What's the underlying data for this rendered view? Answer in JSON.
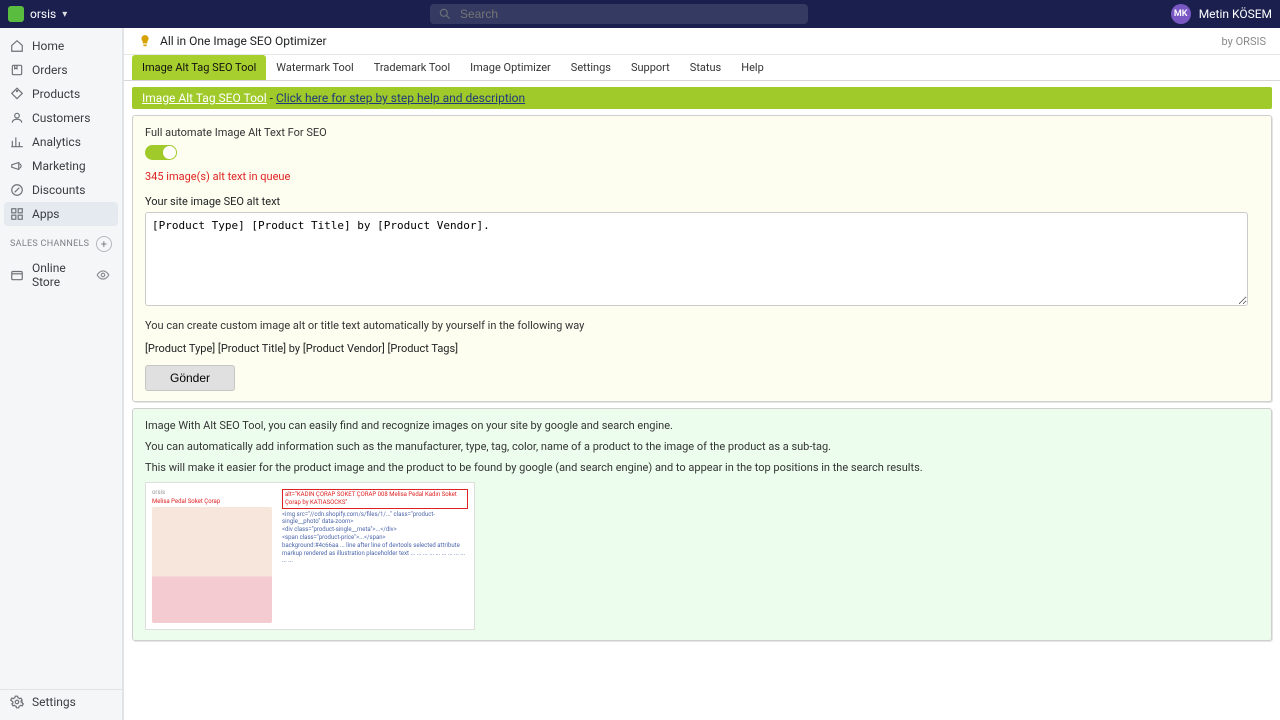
{
  "topbar": {
    "store_name": "orsis",
    "search_placeholder": "Search",
    "user_initials": "MK",
    "user_name": "Metin KÖSEM"
  },
  "sidebar": {
    "items": [
      {
        "label": "Home"
      },
      {
        "label": "Orders"
      },
      {
        "label": "Products"
      },
      {
        "label": "Customers"
      },
      {
        "label": "Analytics"
      },
      {
        "label": "Marketing"
      },
      {
        "label": "Discounts"
      },
      {
        "label": "Apps"
      }
    ],
    "channels_header": "SALES CHANNELS",
    "channels": [
      {
        "label": "Online Store"
      }
    ],
    "settings_label": "Settings"
  },
  "app": {
    "title": "All in One Image SEO Optimizer",
    "by_vendor": "by ORSIS"
  },
  "tabs": {
    "items": [
      {
        "label": "Image Alt Tag SEO Tool"
      },
      {
        "label": "Watermark Tool"
      },
      {
        "label": "Trademark Tool"
      },
      {
        "label": "Image Optimizer"
      },
      {
        "label": "Settings"
      },
      {
        "label": "Support"
      },
      {
        "label": "Status"
      },
      {
        "label": "Help"
      }
    ]
  },
  "greenbar": {
    "title": "Image Alt Tag SEO Tool",
    "sep": " - ",
    "link": "Click here for step by step help and description"
  },
  "panel": {
    "automate_label": "Full automate Image Alt Text For SEO",
    "queue_text": "345 image(s) alt text in queue",
    "alt_label": "Your site image SEO alt text",
    "alt_value": "[Product Type] [Product Title] by [Product Vendor].",
    "hint": "You can create custom image alt or title text automatically by yourself in the following way",
    "template": "[Product Type] [Product Title] by [Product Vendor] [Product Tags]",
    "submit_label": "Gönder"
  },
  "info": {
    "p1": "Image With Alt SEO Tool, you can easily find and recognize images on your site by google and search engine.",
    "p2": "You can automatically add information such as the manufacturer, type, tag, color, name of a product to the image of the product as a sub-tag.",
    "p3": "This will make it easier for the product image and the product to be found by google (and search engine) and to appear in the top positions in the search results."
  }
}
